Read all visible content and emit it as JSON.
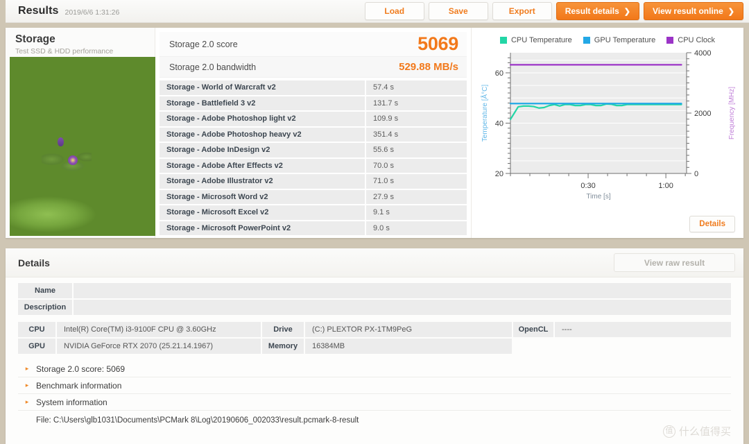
{
  "topbar": {
    "title": "Results",
    "date": "2019/6/6 1:31:26",
    "buttons": {
      "load": "Load",
      "save": "Save",
      "export": "Export",
      "result_details": "Result details",
      "view_online": "View result online",
      "chevron": "❯"
    }
  },
  "storage": {
    "title": "Storage",
    "subtitle": "Test SSD & HDD performance",
    "image_name": "lily-pads-photo"
  },
  "scores": {
    "score_label": "Storage 2.0 score",
    "score_value": "5069",
    "bandwidth_label": "Storage 2.0 bandwidth",
    "bandwidth_value": "529.88 MB/s",
    "benchmarks": [
      {
        "name": "Storage - World of Warcraft v2",
        "value": "57.4 s"
      },
      {
        "name": "Storage - Battlefield 3 v2",
        "value": "131.7 s"
      },
      {
        "name": "Storage - Adobe Photoshop light v2",
        "value": "109.9 s"
      },
      {
        "name": "Storage - Adobe Photoshop heavy v2",
        "value": "351.4 s"
      },
      {
        "name": "Storage - Adobe InDesign v2",
        "value": "55.6 s"
      },
      {
        "name": "Storage - Adobe After Effects v2",
        "value": "70.0 s"
      },
      {
        "name": "Storage - Adobe Illustrator v2",
        "value": "71.0 s"
      },
      {
        "name": "Storage - Microsoft Word v2",
        "value": "27.9 s"
      },
      {
        "name": "Storage - Microsoft Excel v2",
        "value": "9.1 s"
      },
      {
        "name": "Storage - Microsoft PowerPoint v2",
        "value": "9.0 s"
      }
    ]
  },
  "chart_panel": {
    "details_button": "Details"
  },
  "chart_data": {
    "type": "line",
    "title": "",
    "xlabel": "Time [s]",
    "ylabel": "Temperature [Å°C]",
    "y2label": "Frequency [MHz]",
    "xlim": [
      0,
      68
    ],
    "ylim": [
      20,
      68
    ],
    "y2lim": [
      0,
      4000
    ],
    "xticks": [
      "0:30",
      "1:00"
    ],
    "xtick_values": [
      30,
      60
    ],
    "yticks": [
      20,
      40,
      60
    ],
    "y2ticks": [
      0,
      2000,
      4000
    ],
    "grid": true,
    "legend_position": "top",
    "legend": [
      {
        "name": "CPU Temperature",
        "color": "#22d6a6"
      },
      {
        "name": "GPU Temperature",
        "color": "#23a8e6"
      },
      {
        "name": "CPU Clock",
        "color": "#9b34c7"
      }
    ],
    "series": [
      {
        "name": "CPU Temperature",
        "color": "#22d6a6",
        "axis": "left",
        "unit": "°C",
        "x": [
          0,
          1.5,
          3,
          5,
          7,
          9,
          11,
          13,
          15,
          17,
          19,
          21,
          23,
          25,
          27,
          29,
          31,
          33,
          35,
          37,
          39,
          41,
          43,
          45,
          47,
          50,
          54,
          58,
          62,
          66
        ],
        "values": [
          41.5,
          44.0,
          46.5,
          46.8,
          46.8,
          46.6,
          46.0,
          46.2,
          47.0,
          47.4,
          46.8,
          47.4,
          47.4,
          47.0,
          47.0,
          47.4,
          47.4,
          47.0,
          47.0,
          47.6,
          47.5,
          47.0,
          47.0,
          47.4,
          47.4,
          47.4,
          47.4,
          47.4,
          47.4,
          47.4
        ]
      },
      {
        "name": "GPU Temperature",
        "color": "#23a8e6",
        "axis": "left",
        "unit": "°C",
        "x": [
          0,
          10,
          20,
          30,
          40,
          50,
          60,
          66
        ],
        "values": [
          47.8,
          47.8,
          47.8,
          47.8,
          47.8,
          47.8,
          47.8,
          47.8
        ]
      },
      {
        "name": "CPU Clock",
        "color": "#9b34c7",
        "axis": "right",
        "unit": "MHz",
        "x": [
          0,
          10,
          20,
          30,
          40,
          50,
          60,
          66
        ],
        "values": [
          3600,
          3600,
          3600,
          3600,
          3600,
          3600,
          3600,
          3600
        ]
      }
    ]
  },
  "details": {
    "title": "Details",
    "view_raw": "View raw result",
    "fields": {
      "name_label": "Name",
      "name_value": "",
      "description_label": "Description",
      "description_value": "",
      "cpu_label": "CPU",
      "cpu_value": "Intel(R) Core(TM) i3-9100F CPU @ 3.60GHz",
      "gpu_label": "GPU",
      "gpu_value": "NVIDIA GeForce RTX 2070 (25.21.14.1967)",
      "drive_label": "Drive",
      "drive_value": "(C:) PLEXTOR PX-1TM9PeG",
      "memory_label": "Memory",
      "memory_value": "16384MB",
      "opencl_label": "OpenCL",
      "opencl_value": "----"
    },
    "accordion": [
      {
        "label": "Storage 2.0 score: 5069",
        "arrow": "▸"
      },
      {
        "label": "Benchmark information",
        "arrow": "▸"
      },
      {
        "label": "System information",
        "arrow": "▸"
      }
    ],
    "file_line": "File: C:\\Users\\glb1031\\Documents\\PCMark 8\\Log\\20190606_002033\\result.pcmark-8-result"
  },
  "watermark": {
    "mark": "值",
    "text": "什么值得买"
  },
  "colors": {
    "accent": "#f2791b",
    "cpu_temp": "#22d6a6",
    "gpu_temp": "#23a8e6",
    "cpu_clock": "#9b34c7",
    "page_bg": "#cfc6b4"
  }
}
